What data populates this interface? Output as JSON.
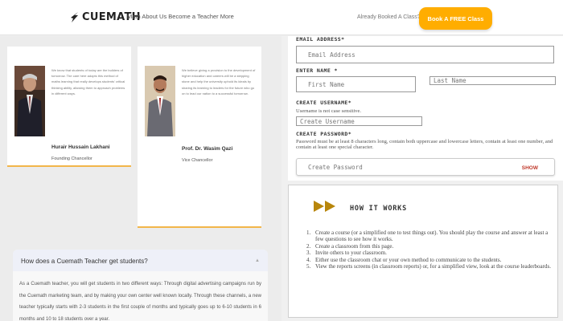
{
  "header": {
    "logo_text": "CUEMATH",
    "nav_text": "Math  About Us  Become a Teacher  More",
    "already_text": "Already Booked A Class?",
    "cta_label": "Book A FREE Class"
  },
  "people": [
    {
      "quote": "We know that students of today are the builders of tomorrow. The care here adopts this method of maths learning that really develops students' critical thinking ability, allowing them to approach problems in different ways.",
      "name": "Hurair Hussain Lakhani",
      "role": "Founding Chancellor"
    },
    {
      "quote": "We believe giving a provision to the development of higher education and careers will be a stepping stone and help the university uphold its ideals by sharing its learning to leaders for the future who go on to lead our nation to a successful tomorrow.",
      "name": "Prof. Dr. Wasim Qazi",
      "role": "Vice Chancellor"
    }
  ],
  "faq": {
    "question": "How does a Cuemath Teacher get students?",
    "answer": "As a Cuemath teacher, you will get students in two different ways: Through digital advertising campaigns run by the Cuemath marketing team, and by making your own center well known locally. Through these channels, a new teacher typically starts with 2-3 students in the first couple of months and typically goes up to 6-10 students in 6 months and 10 to 18 students over a year."
  },
  "form": {
    "email_label": "EMAIL ADDRESS*",
    "email_placeholder": "Email Address",
    "name_label": "ENTER NAME *",
    "first_name_placeholder": "First Name",
    "last_name_placeholder": "Last Name",
    "username_label": "CREATE USERNAME*",
    "username_hint": "Username is not case sensitive.",
    "username_placeholder": "Create Username",
    "password_label": "CREATE PASSWORD*",
    "password_hint": "Password must be at least 8 characters long, contain both uppercase and lowercase letters, contain at least one number, and contain at least one special character.",
    "password_placeholder": "Create Password",
    "show_label": "SHOW"
  },
  "how": {
    "title": "HOW IT WORKS",
    "steps": [
      {
        "num": "1.",
        "text": "Create a course (or a simplified one to test things out). You should play the course and answer at least a few questions to see how it works."
      },
      {
        "num": "2.",
        "text": "Create a classroom from this page."
      },
      {
        "num": "3.",
        "text": "Invite others to your classroom."
      },
      {
        "num": "4.",
        "text": "Either use the classroom chat or your own method to communicate to the students."
      },
      {
        "num": "5.",
        "text": "View the reports screens (in classroom reports) or, for a simplified view, look at the course leaderboards."
      }
    ]
  },
  "colors": {
    "accent": "#ffad00",
    "card_border": "#f2b64a",
    "show": "#c0392b",
    "arrows": "#b8860b"
  }
}
